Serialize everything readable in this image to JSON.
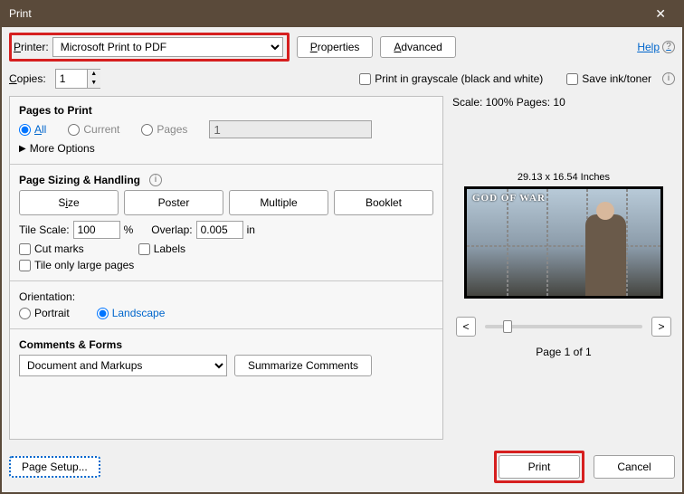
{
  "window": {
    "title": "Print"
  },
  "top": {
    "printer_label": "Printer:",
    "printer_value": "Microsoft Print to PDF",
    "properties": "Properties",
    "advanced": "Advanced",
    "help": "Help"
  },
  "second": {
    "copies_label": "Copies:",
    "copies_value": "1",
    "grayscale": "Print in grayscale (black and white)",
    "saveink": "Save ink/toner"
  },
  "pages": {
    "title": "Pages to Print",
    "all": "All",
    "current": "Current",
    "pages": "Pages",
    "pages_value": "1",
    "more": "More Options"
  },
  "sizing": {
    "title": "Page Sizing & Handling",
    "size": "Size",
    "poster": "Poster",
    "multiple": "Multiple",
    "booklet": "Booklet",
    "tilescale": "Tile Scale:",
    "tilescale_value": "100",
    "tilescale_unit": "%",
    "overlap": "Overlap:",
    "overlap_value": "0.005",
    "overlap_unit": "in",
    "cutmarks": "Cut marks",
    "labels": "Labels",
    "tileonly": "Tile only large pages"
  },
  "orientation": {
    "title": "Orientation:",
    "portrait": "Portrait",
    "landscape": "Landscape"
  },
  "comments": {
    "title": "Comments & Forms",
    "value": "Document and Markups",
    "summarize": "Summarize Comments"
  },
  "preview": {
    "scaleinfo": "Scale: 100% Pages: 10",
    "dims": "29.13 x 16.54 Inches",
    "logo": "GOD OF WAR",
    "prev": "<",
    "next": ">",
    "pageof": "Page 1 of 1"
  },
  "footer": {
    "pagesetup": "Page Setup...",
    "print": "Print",
    "cancel": "Cancel"
  }
}
